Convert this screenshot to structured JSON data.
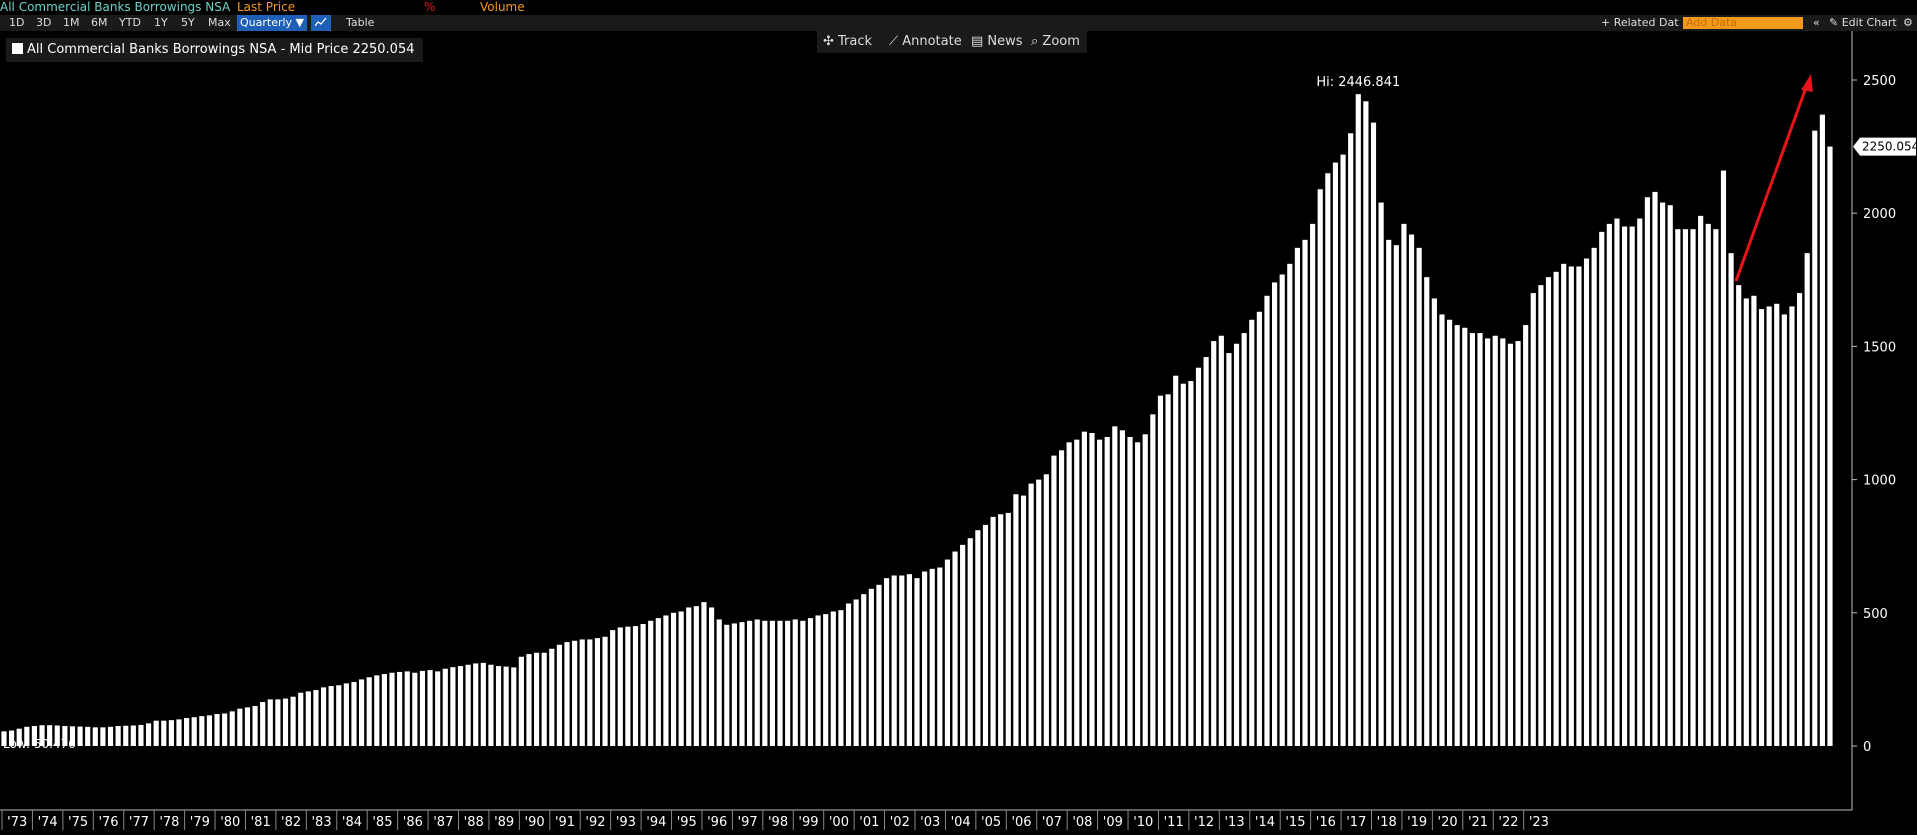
{
  "header": {
    "security": "All Commercial Banks Borrowings NSA",
    "last_price": "Last Price",
    "pct": "%",
    "volume": "Volume",
    "periods": [
      "1D",
      "3D",
      "1M",
      "6M",
      "YTD",
      "1Y",
      "5Y",
      "Max"
    ],
    "frequency": "Quarterly ▼",
    "table": "Table",
    "related": "+ Related Dat",
    "add_data_placeholder": "Add Data",
    "collapse": "«",
    "edit_chart": "✎ Edit Chart",
    "settings": "⚙"
  },
  "legend": {
    "label": "All Commercial Banks Borrowings NSA - Mid Price 2250.054"
  },
  "tools": {
    "track": "Track",
    "annotate": "Annotate",
    "news": "News",
    "zoom": "Zoom"
  },
  "colors": {
    "background": "#000000",
    "bars": "#ffffff",
    "arrow": "#e8141c",
    "label_security": "#6cd3c8",
    "label_field": "#f39a1c",
    "accent_blue": "#1e5fb8"
  },
  "chart_data": {
    "type": "bar",
    "title": "All Commercial Banks Borrowings NSA",
    "frequency": "Quarterly",
    "series": [
      {
        "name": "All Commercial Banks Borrowings NSA - Mid Price",
        "values": [
          55,
          58,
          65,
          72,
          75,
          78,
          78,
          77,
          75,
          74,
          73,
          72,
          70,
          70,
          72,
          75,
          76,
          77,
          79,
          85,
          95,
          95,
          97,
          100,
          105,
          108,
          112,
          115,
          120,
          122,
          130,
          140,
          145,
          150,
          165,
          175,
          175,
          178,
          185,
          200,
          205,
          210,
          220,
          225,
          228,
          235,
          240,
          250,
          258,
          265,
          270,
          275,
          278,
          280,
          275,
          282,
          285,
          280,
          290,
          296,
          300,
          305,
          310,
          312,
          305,
          300,
          298,
          295,
          335,
          345,
          350,
          350,
          365,
          380,
          390,
          395,
          400,
          400,
          405,
          410,
          435,
          445,
          448,
          450,
          458,
          470,
          480,
          490,
          500,
          505,
          520,
          525,
          540,
          520,
          475,
          455,
          460,
          465,
          470,
          475,
          470,
          470,
          470,
          470,
          475,
          470,
          480,
          490,
          495,
          505,
          510,
          535,
          550,
          570,
          590,
          605,
          630,
          640,
          640,
          645,
          630,
          655,
          665,
          670,
          700,
          730,
          755,
          780,
          810,
          830,
          860,
          870,
          875,
          945,
          940,
          985,
          1000,
          1020,
          1090,
          1110,
          1140,
          1150,
          1180,
          1175,
          1150,
          1160,
          1200,
          1185,
          1160,
          1140,
          1170,
          1245,
          1315,
          1320,
          1390,
          1360,
          1370,
          1420,
          1460,
          1520,
          1540,
          1475,
          1510,
          1550,
          1600,
          1630,
          1690,
          1740,
          1770,
          1810,
          1870,
          1900,
          1960,
          2090,
          2150,
          2190,
          2220,
          2300,
          2446.841,
          2420,
          2340,
          2040,
          1900,
          1880,
          1960,
          1920,
          1870,
          1760,
          1680,
          1620,
          1600,
          1580,
          1570,
          1550,
          1550,
          1530,
          1540,
          1530,
          1510,
          1520,
          1580,
          1700,
          1730,
          1760,
          1780,
          1810,
          1800,
          1800,
          1830,
          1870,
          1930,
          1960,
          1980,
          1950,
          1950,
          1980,
          2060,
          2080,
          2040,
          2030,
          1940,
          1940,
          1940,
          1990,
          1960,
          1940,
          2160,
          1850,
          1730,
          1680,
          1690,
          1640,
          1650,
          1660,
          1620,
          1650,
          1700,
          1850,
          2310,
          2370,
          2250.054
        ]
      }
    ],
    "x_start": "1972 Q4",
    "xlabels": [
      "'73",
      "'74",
      "'75",
      "'76",
      "'77",
      "'78",
      "'79",
      "'80",
      "'81",
      "'82",
      "'83",
      "'84",
      "'85",
      "'86",
      "'87",
      "'88",
      "'89",
      "'90",
      "'91",
      "'92",
      "'93",
      "'94",
      "'95",
      "'96",
      "'97",
      "'98",
      "'99",
      "'00",
      "'01",
      "'02",
      "'03",
      "'04",
      "'05",
      "'06",
      "'07",
      "'08",
      "'09",
      "'10",
      "'11",
      "'12",
      "'13",
      "'14",
      "'15",
      "'16",
      "'17",
      "'18",
      "'19",
      "'20",
      "'21",
      "'22",
      "'23"
    ],
    "yticks": [
      0,
      500,
      1000,
      1500,
      2000,
      2500
    ],
    "ytick_labels": [
      "0",
      "500",
      "1000",
      "1500",
      "2000",
      "2500"
    ],
    "ylim": [
      0,
      2500
    ],
    "axis_position": "right",
    "hi_label": "Hi: 2446.841",
    "low_label": "Low: 50.476",
    "last_value_label": "2250.054",
    "annotation": "red arrow pointing up-right over 2021–2023"
  }
}
